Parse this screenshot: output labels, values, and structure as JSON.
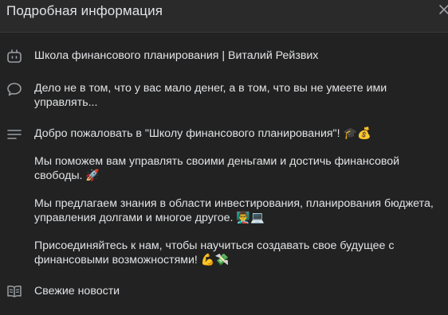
{
  "header": {
    "title": "Подробная информация",
    "close_icon": "close-icon"
  },
  "rows": {
    "name": {
      "icon": "bot-icon",
      "text": "Школа финансового планирования | Виталий Рейзвих"
    },
    "status": {
      "icon": "speech-bubble-icon",
      "line1": "Дело не в том, что у вас мало денег, а в том, что вы не умеете ими",
      "line2": "управлять..."
    },
    "description": {
      "icon": "text-lines-icon",
      "p1": "Добро пожаловать в \"Школу финансового планирования\"! 🎓💰",
      "p2_line1": "Мы поможем вам управлять своими деньгами и достичь финансовой",
      "p2_line2": "свободы. 🚀",
      "p3_line1": "Мы предлагаем знания в области инвестирования, планирования бюджета,",
      "p3_line2": "управления долгами и многое другое. 👨‍🏫💻",
      "p4_line1": "Присоединяйтесь к нам, чтобы научиться создавать свое будущее с",
      "p4_line2": "финансовыми возможностями! 💪💸"
    },
    "news": {
      "icon": "open-book-icon",
      "link": "Свежие новости"
    }
  },
  "colors": {
    "background": "#222222",
    "header_background": "#2a2a2a",
    "text": "#e1e3e6",
    "icon": "#9a9ea3",
    "link": "#71aaeb"
  }
}
